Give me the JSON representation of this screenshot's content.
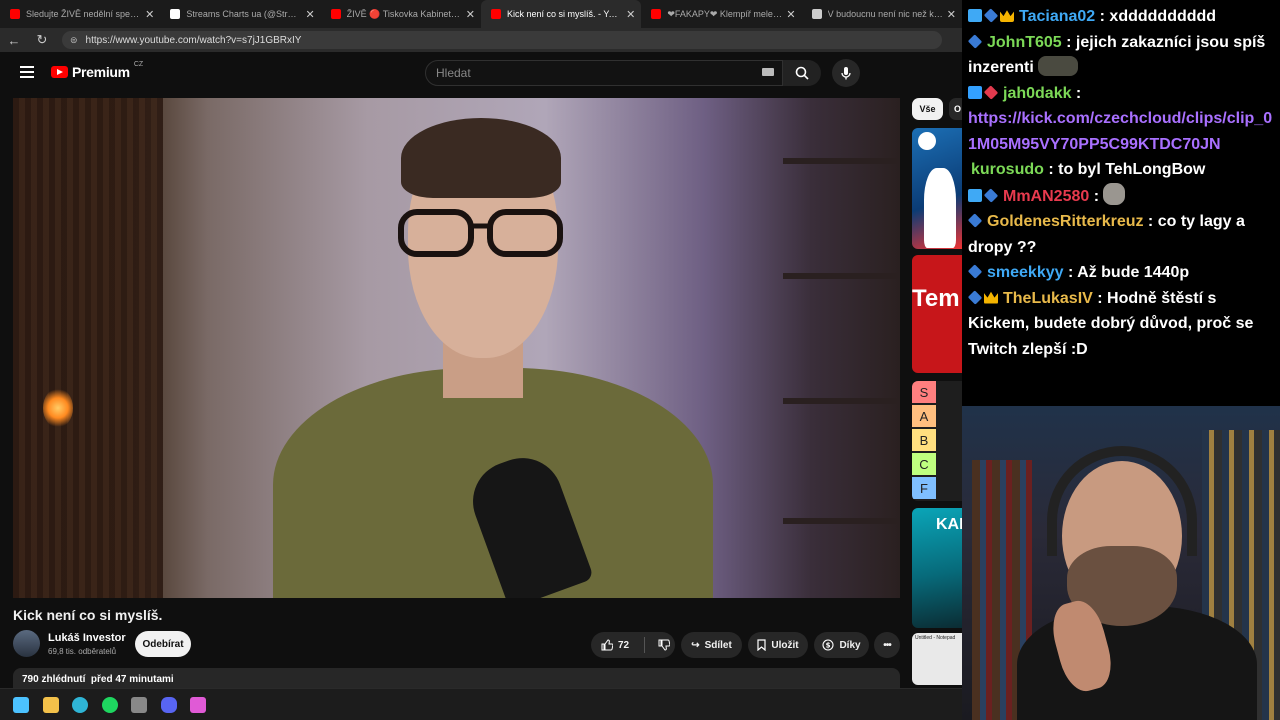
{
  "browser": {
    "tabs": [
      {
        "label": "Sledujte ŽIVĚ nedělní speciál se Š",
        "color": "#ff0000",
        "active": false
      },
      {
        "label": "Streams Charts ua (@StreamsChar",
        "color": "#ffffff",
        "active": false
      },
      {
        "label": "ŽIVĚ 🔴 Tiskovka Kabinetu budou",
        "color": "#ff0000",
        "active": false
      },
      {
        "label": "Kick není co si myslíš. - YouTube",
        "color": "#ff0000",
        "active": true
      },
      {
        "label": "❤FAKAPY❤ Klempíř mele hůř ja",
        "color": "#ff0000",
        "active": false
      },
      {
        "label": "V budoucnu není nic než kulturní",
        "color": "#cccccc",
        "active": false
      }
    ],
    "close_glyph": "✕",
    "url": "https://www.youtube.com/watch?v=s7jJ1GBRxIY"
  },
  "youtube": {
    "logo_text": "Premium",
    "country": "CZ",
    "search_placeholder": "Hledat",
    "video": {
      "title": "Kick není co si myslíš.",
      "channel": "Lukáš Investor",
      "subscribers": "69,8 tis. odběratelů",
      "subscribe_label": "Odebírat",
      "likes": "72",
      "share_label": "Sdílet",
      "save_label": "Uložit",
      "thanks_label": "Díky",
      "views_time": "790 zhlédnutí  před 47 minutami"
    },
    "chips": {
      "all": "Vše",
      "next": "O"
    },
    "thumbs": {
      "thumb2_text": "Tem",
      "tiers": [
        "S",
        "A",
        "B",
        "C",
        "F"
      ],
      "tier_colors": [
        "#ff7f7f",
        "#ffbf7f",
        "#ffdf7f",
        "#bfff7f",
        "#7fbfff"
      ],
      "thumb4_text": "KAM",
      "thumb5_text": "Untitled - Notepad"
    }
  },
  "chat": {
    "messages": [
      {
        "badges": [
          "b-cube",
          "b-blue",
          "b-crown"
        ],
        "user": "Taciana02",
        "color": "#3fa9f5",
        "text": "xdddddddddd",
        "emote": ""
      },
      {
        "badges": [
          "b-blue"
        ],
        "user": "JohnT605",
        "color": "#7cd957",
        "text": "jejich zakazníci jsou spíš inzerenti",
        "emote": "emote"
      },
      {
        "badges": [
          "b-arrow",
          "b-red"
        ],
        "user": "jah0dakk",
        "color": "#7cd957",
        "text": "",
        "emote": ""
      },
      {
        "badges": [],
        "user": "",
        "color": "#ffffff",
        "text": "https://kick.com/czechcloud/clips/clip_01M05M95VY70PP5C99KTDC70JN",
        "emote": "",
        "link": true
      },
      {
        "badges": [],
        "user": "kurosudo",
        "color": "#7cd957",
        "text": "to byl TehLongBow",
        "emote": ""
      },
      {
        "badges": [
          "b-cube",
          "b-blue"
        ],
        "user": "MmAN2580",
        "color": "#e83a4e",
        "text": "",
        "emote": "cat"
      },
      {
        "badges": [
          "b-blue"
        ],
        "user": "GoldenesRitterkreuz",
        "color": "#e8b94a",
        "text": "co ty lagy a dropy ??",
        "emote": ""
      },
      {
        "badges": [
          "b-blue"
        ],
        "user": "smeekkyy",
        "color": "#3fa9f5",
        "text": "Až bude 1440p",
        "emote": ""
      },
      {
        "badges": [
          "b-blue",
          "b-crown"
        ],
        "user": "TheLukasIV",
        "color": "#e8b94a",
        "text": "Hodně štěstí s Kickem, budete dobrý důvod, proč se Twitch zlepší :D",
        "emote": ""
      }
    ]
  },
  "taskbar": {
    "icons": [
      {
        "name": "windows-start-icon",
        "color": "#4cc2ff"
      },
      {
        "name": "file-explorer-icon",
        "color": "#f3c14a"
      },
      {
        "name": "edge-icon",
        "color": "#2fb5d6"
      },
      {
        "name": "spotify-icon",
        "color": "#1ed760"
      },
      {
        "name": "obs-icon",
        "color": "#888888"
      },
      {
        "name": "discord-icon",
        "color": "#5865f2"
      },
      {
        "name": "copilot-icon",
        "color": "#e05ad6"
      }
    ]
  }
}
